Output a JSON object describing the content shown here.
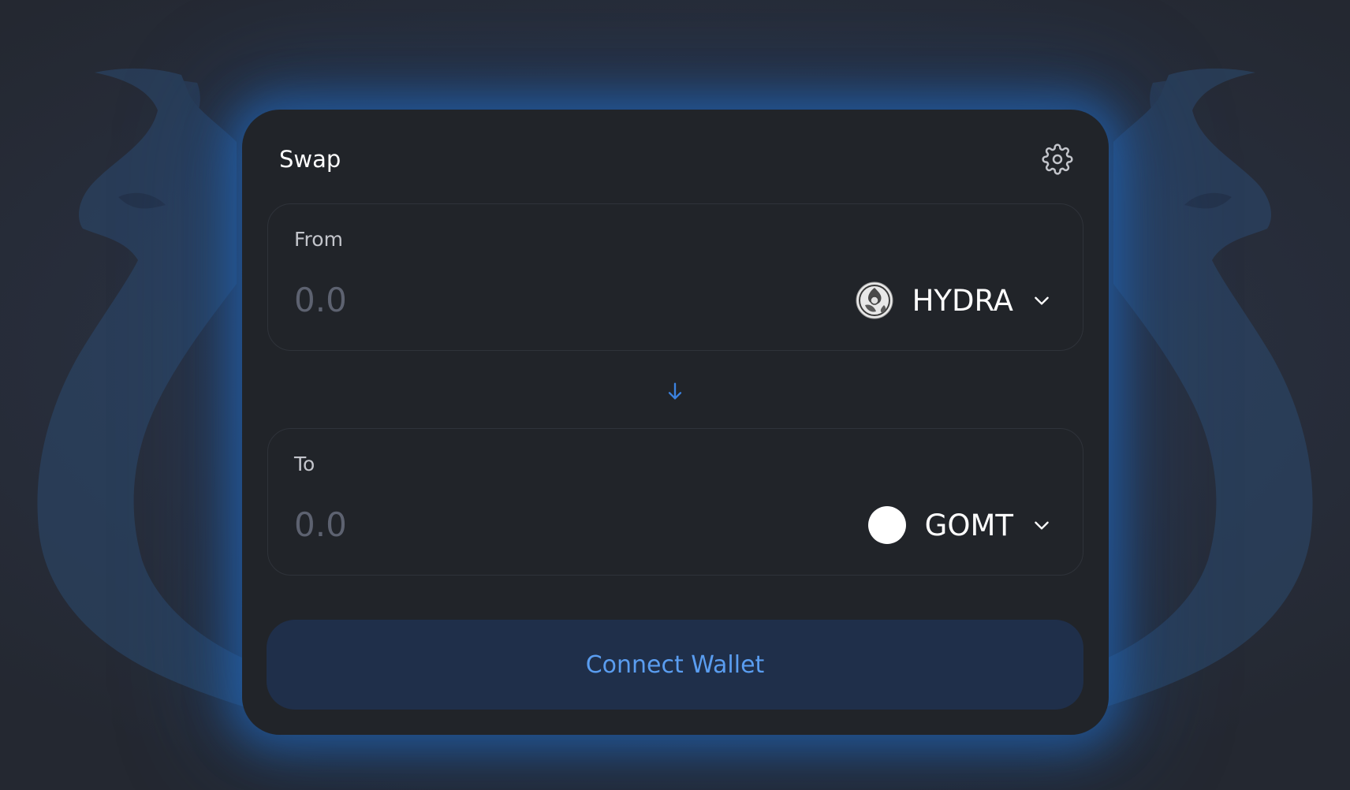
{
  "swap": {
    "title": "Swap",
    "settings_icon": "gear-icon"
  },
  "from": {
    "label": "From",
    "amount_placeholder": "0.0",
    "token": {
      "symbol": "HYDRA",
      "icon": "hydra-token-icon"
    }
  },
  "switch_icon": "arrow-down-icon",
  "to": {
    "label": "To",
    "amount_placeholder": "0.0",
    "token": {
      "symbol": "GOMT",
      "icon": "gomt-token-icon"
    }
  },
  "connect_wallet_label": "Connect Wallet",
  "colors": {
    "card_background": "#212429",
    "accent": "#3b82e0",
    "button_background": "#1f2f4a",
    "button_text": "#5a9df0",
    "glow": "#206ec8"
  }
}
